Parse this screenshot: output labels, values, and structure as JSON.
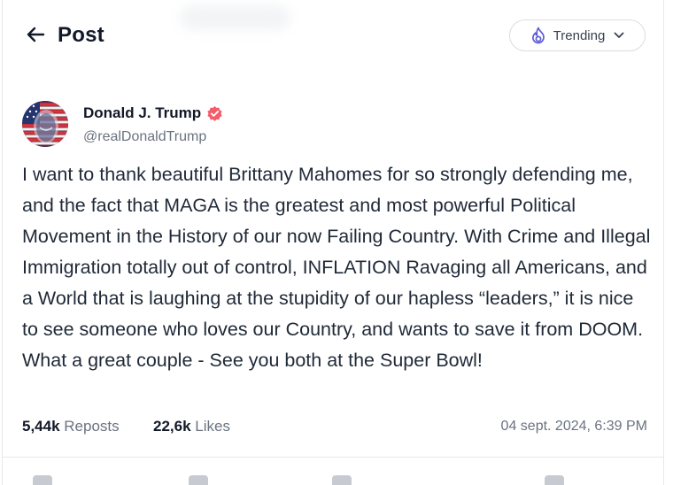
{
  "header": {
    "title": "Post",
    "filter": {
      "label": "Trending"
    }
  },
  "post": {
    "author": {
      "display_name": "Donald J. Trump",
      "handle": "@realDonaldTrump",
      "verified": true
    },
    "text": "I want to thank beautiful Brittany Mahomes for so strongly defending me, and the fact that MAGA is the greatest and most powerful Political Movement in the History of our now Failing Country. With Crime and Illegal Immigration totally out of control, INFLATION Ravaging all Americans, and a World that is laughing at the stupidity of our hapless “leaders,” it is nice to see someone who loves our Country, and wants to save it from DOOM. What a great couple - See you both at the Super Bowl!",
    "stats": {
      "reposts_count": "5,44k",
      "reposts_label": "Reposts",
      "likes_count": "22,6k",
      "likes_label": "Likes"
    },
    "timestamp": "04 sept. 2024, 6:39 PM"
  },
  "colors": {
    "accent": "#5b5bd6",
    "verified_badge": "#f25c6b",
    "muted_text": "#6b7280",
    "border": "#e6e8ec"
  },
  "icons": [
    "back-arrow-icon",
    "flame-icon",
    "chevron-down-icon",
    "verified-badge-icon"
  ]
}
